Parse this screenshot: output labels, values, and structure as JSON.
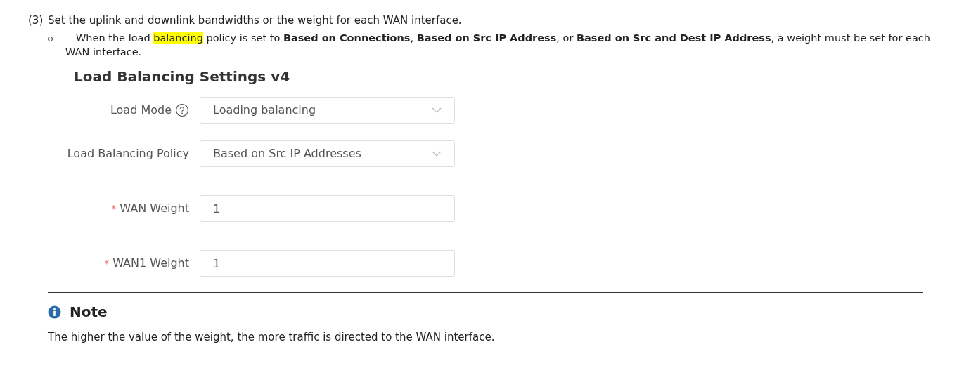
{
  "step": {
    "number": "(3)",
    "text": "Set the uplink and downlink bandwidths or the weight for each WAN interface."
  },
  "bullet": {
    "segments": [
      {
        "kind": "plain",
        "text": "When the load "
      },
      {
        "kind": "highlight",
        "text": "balancing"
      },
      {
        "kind": "plain",
        "text": " policy is set to "
      },
      {
        "kind": "bold",
        "text": "Based on Connections"
      },
      {
        "kind": "plain",
        "text": ", "
      },
      {
        "kind": "bold",
        "text": "Based on Src IP Address"
      },
      {
        "kind": "plain",
        "text": ", or "
      },
      {
        "kind": "bold",
        "text": "Based on Src and Dest IP Address"
      },
      {
        "kind": "plain",
        "text": ", a weight must be set for each WAN interface."
      }
    ]
  },
  "settings": {
    "title": "Load Balancing Settings v4",
    "fields": [
      {
        "kind": "select",
        "label": "Load Mode",
        "help": true,
        "value": "Loading balancing"
      },
      {
        "kind": "select",
        "label": "Load Balancing Policy",
        "help": false,
        "value": "Based on Src IP Addresses"
      },
      {
        "kind": "input",
        "required_mark": "*",
        "label": "WAN Weight",
        "help": false,
        "value": "1"
      },
      {
        "kind": "input",
        "required_mark": "*",
        "label": "WAN1 Weight",
        "help": false,
        "value": "1"
      }
    ]
  },
  "note": {
    "title": "Note",
    "text": "The higher the value of the weight, the more traffic is directed to the WAN interface."
  }
}
